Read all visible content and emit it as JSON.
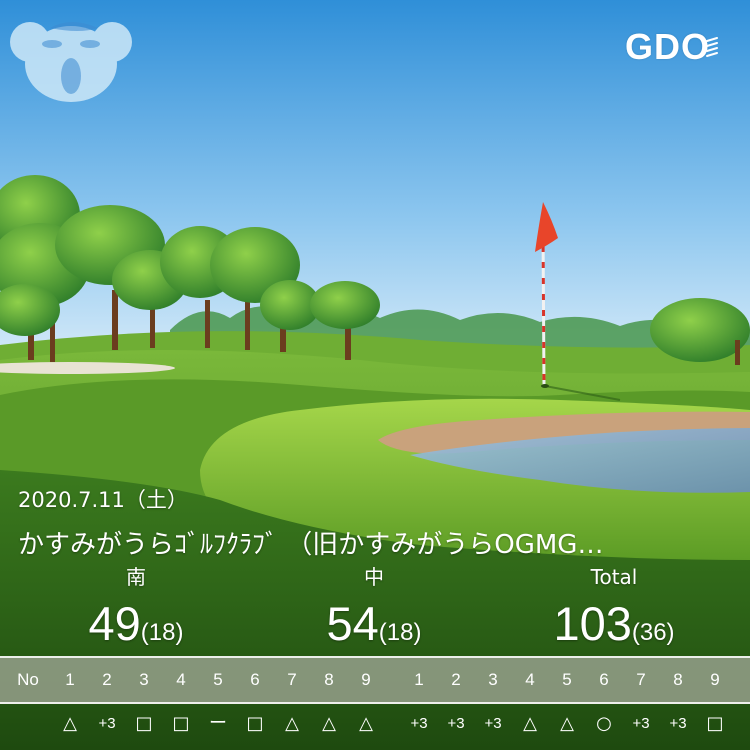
{
  "brand": {
    "logo_text": "GDO"
  },
  "round": {
    "date": "2020.7.11（土）",
    "course_name": "かすみがうらｺﾞﾙﾌｸﾗﾌﾞ （旧かすみがうらOGMG…"
  },
  "scores": [
    {
      "label": "南",
      "total": "49",
      "sub": "(18)"
    },
    {
      "label": "中",
      "total": "54",
      "sub": "(18)"
    },
    {
      "label": "Total",
      "total": "103",
      "sub": "(36)"
    }
  ],
  "holes": {
    "header_label": "No",
    "front": [
      "1",
      "2",
      "3",
      "4",
      "5",
      "6",
      "7",
      "8",
      "9"
    ],
    "back": [
      "1",
      "2",
      "3",
      "4",
      "5",
      "6",
      "7",
      "8",
      "9"
    ]
  },
  "results": {
    "front": [
      "△",
      "+3",
      "□",
      "□",
      "ー",
      "□",
      "△",
      "△",
      "△"
    ],
    "back": [
      "+3",
      "+3",
      "+3",
      "△",
      "△",
      "○",
      "+3",
      "+3",
      "□"
    ]
  }
}
